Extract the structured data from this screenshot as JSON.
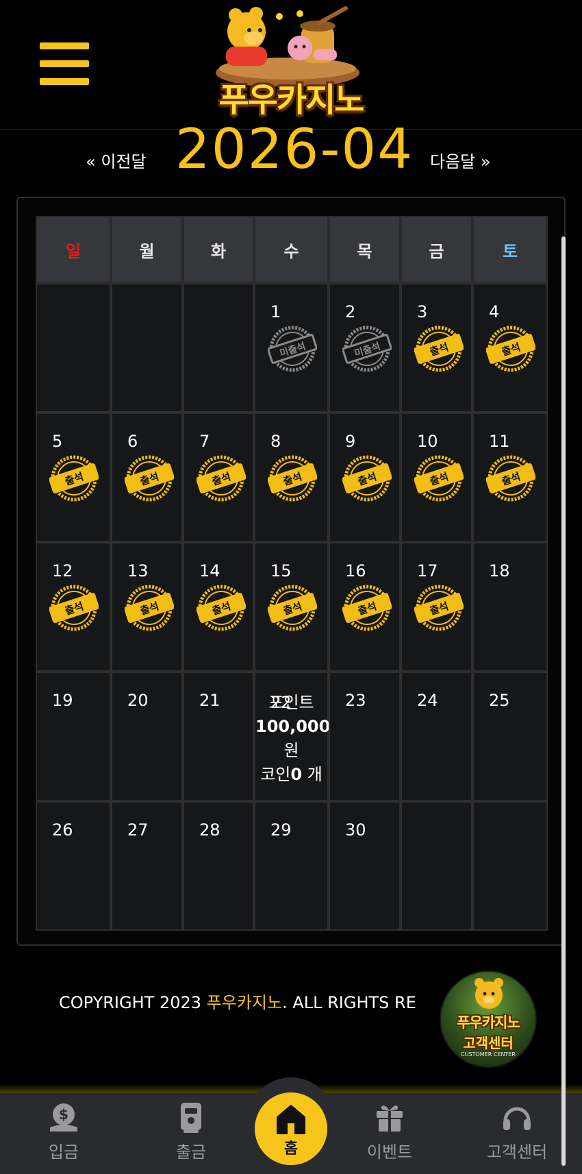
{
  "header": {
    "logo_text": "푸우카지노"
  },
  "calendar": {
    "prev_label": "« 이전달",
    "next_label": "다음달 »",
    "month": "2026-04",
    "weekdays": [
      "일",
      "월",
      "화",
      "수",
      "목",
      "금",
      "토"
    ],
    "weeks": [
      [
        {
          "day": "",
          "stamp": ""
        },
        {
          "day": "",
          "stamp": ""
        },
        {
          "day": "",
          "stamp": ""
        },
        {
          "day": "1",
          "stamp": "미출석"
        },
        {
          "day": "2",
          "stamp": "미출석"
        },
        {
          "day": "3",
          "stamp": "출석"
        },
        {
          "day": "4",
          "stamp": "출석"
        }
      ],
      [
        {
          "day": "5",
          "stamp": "출석"
        },
        {
          "day": "6",
          "stamp": "출석"
        },
        {
          "day": "7",
          "stamp": "출석"
        },
        {
          "day": "8",
          "stamp": "출석"
        },
        {
          "day": "9",
          "stamp": "출석"
        },
        {
          "day": "10",
          "stamp": "출석"
        },
        {
          "day": "11",
          "stamp": "출석"
        }
      ],
      [
        {
          "day": "12",
          "stamp": "출석"
        },
        {
          "day": "13",
          "stamp": "출석"
        },
        {
          "day": "14",
          "stamp": "출석"
        },
        {
          "day": "15",
          "stamp": "출석"
        },
        {
          "day": "16",
          "stamp": "출석"
        },
        {
          "day": "17",
          "stamp": "출석"
        },
        {
          "day": "18",
          "stamp": ""
        }
      ],
      [
        {
          "day": "19",
          "stamp": ""
        },
        {
          "day": "20",
          "stamp": ""
        },
        {
          "day": "21",
          "stamp": ""
        },
        {
          "day": "22",
          "stamp": ""
        },
        {
          "day": "23",
          "stamp": ""
        },
        {
          "day": "24",
          "stamp": ""
        },
        {
          "day": "25",
          "stamp": ""
        }
      ],
      [
        {
          "day": "26",
          "stamp": ""
        },
        {
          "day": "27",
          "stamp": ""
        },
        {
          "day": "28",
          "stamp": ""
        },
        {
          "day": "29",
          "stamp": ""
        },
        {
          "day": "30",
          "stamp": ""
        },
        {
          "day": "",
          "stamp": ""
        },
        {
          "day": "",
          "stamp": ""
        }
      ]
    ],
    "today_info": {
      "day": "22",
      "point_label": "포인트",
      "point_value": "100,000",
      "point_unit": "원",
      "coin_label": "코인",
      "coin_value": "0",
      "coin_unit": " 개"
    }
  },
  "footer": {
    "copyright_prefix": "COPYRIGHT 2023 ",
    "copyright_brand": "푸우카지노",
    "copyright_suffix": ". ALL RIGHTS RE",
    "cs_badge_title": "푸우카지노",
    "cs_badge_subtitle": "고객센터",
    "cs_badge_caption": "CUSTOMER CENTER"
  },
  "bottom_nav": {
    "items": [
      {
        "label": "입금",
        "icon": "deposit-icon"
      },
      {
        "label": "출금",
        "icon": "withdraw-icon"
      },
      {
        "label": "홈",
        "icon": "home-icon"
      },
      {
        "label": "이벤트",
        "icon": "gift-icon"
      },
      {
        "label": "고객센터",
        "icon": "headset-icon"
      }
    ]
  },
  "colors": {
    "accent": "#f7c51a",
    "sunday": "#e0201a",
    "saturday": "#6ec6ff",
    "background": "#000000",
    "cell": "#161719"
  }
}
